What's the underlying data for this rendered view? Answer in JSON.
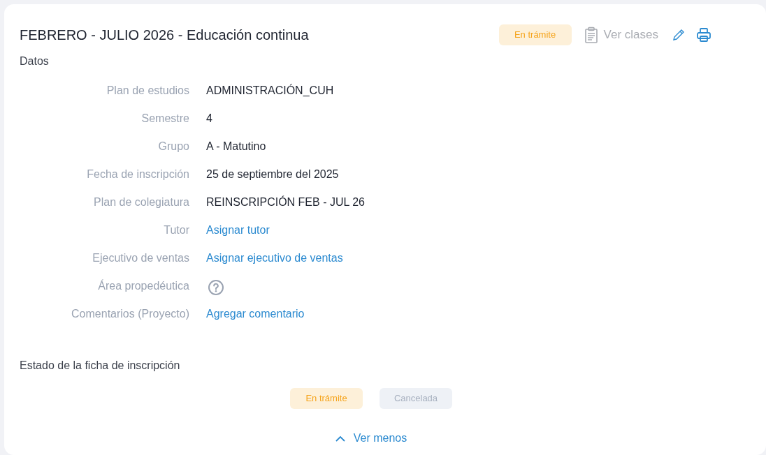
{
  "header": {
    "title": "FEBRERO - JULIO 2026 - Educación continua",
    "status_badge": "En trámite",
    "view_classes": {
      "label": "Ver clases",
      "disabled": true
    }
  },
  "section_title": "Datos",
  "fields": [
    {
      "label": "Plan de estudios",
      "kind": "text",
      "value": "ADMINISTRACIÓN_CUH"
    },
    {
      "label": "Semestre",
      "kind": "text",
      "value": "4"
    },
    {
      "label": "Grupo",
      "kind": "text",
      "value": "A - Matutino"
    },
    {
      "label": "Fecha de inscripción",
      "kind": "text",
      "value": "25 de septiembre del 2025"
    },
    {
      "label": "Plan de colegiatura",
      "kind": "text",
      "value": "REINSCRIPCIÓN FEB - JUL 26"
    },
    {
      "label": "Tutor",
      "kind": "link",
      "value": "Asignar tutor"
    },
    {
      "label": "Ejecutivo de ventas",
      "kind": "link",
      "value": "Asignar ejecutivo de ventas"
    },
    {
      "label": "Área propedéutica",
      "kind": "help"
    },
    {
      "label": "Comentarios (Proyecto)",
      "kind": "link",
      "value": "Agregar comentario"
    }
  ],
  "status_section": {
    "title": "Estado de la ficha de inscripción",
    "options": [
      {
        "label": "En trámite",
        "selected": true
      },
      {
        "label": "Cancelada",
        "selected": false
      }
    ]
  },
  "toggle": "Ver menos"
}
